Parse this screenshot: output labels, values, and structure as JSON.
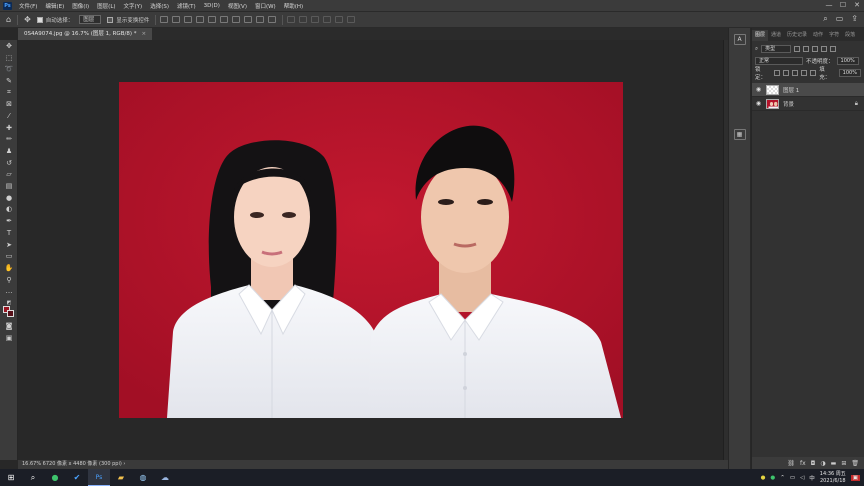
{
  "app": {
    "logo": "Ps"
  },
  "menu": [
    "文件(F)",
    "编辑(E)",
    "图像(I)",
    "图层(L)",
    "文字(Y)",
    "选择(S)",
    "滤镜(T)",
    "3D(D)",
    "视图(V)",
    "窗口(W)",
    "帮助(H)"
  ],
  "window_controls": {
    "minimize": "—",
    "maximize": "☐",
    "close": "✕"
  },
  "options": {
    "auto_select_label": "自动选择：",
    "auto_select_value": "图层",
    "transform_controls_label": "显示变换控件"
  },
  "document_tab": {
    "title": "0S4A9074.jpg @ 16.7% (图层 1, RGB/8) *",
    "close": "×"
  },
  "status": {
    "text": "16.67%   6720 像素 x 4480 像素 (300 ppi)   ›"
  },
  "panels": {
    "tabs": [
      "图层",
      "通道",
      "历史记录",
      "动作",
      "字符",
      "段落"
    ],
    "filter_kind": "类型",
    "blend_mode": "正常",
    "opacity_label": "不透明度：",
    "opacity_value": "100%",
    "lock_label": "锁定：",
    "fill_label": "填充：",
    "fill_value": "100%",
    "layers": [
      {
        "name": "图层 1",
        "selected": true,
        "thumb": "transparent",
        "locked": false
      },
      {
        "name": "背景",
        "selected": false,
        "thumb": "photo",
        "locked": true
      }
    ],
    "bottom_icons": [
      "link-icon",
      "fx-icon",
      "mask-icon",
      "adjustment-icon",
      "group-icon",
      "new-layer-icon",
      "trash-icon"
    ]
  },
  "taskbar": {
    "time": "14:36 周五",
    "date": "2021/6/18",
    "lang": "中"
  },
  "colors": {
    "foreground": "#9a1521",
    "background_swatch": "#571019",
    "photo_backdrop": "#b3132a"
  }
}
